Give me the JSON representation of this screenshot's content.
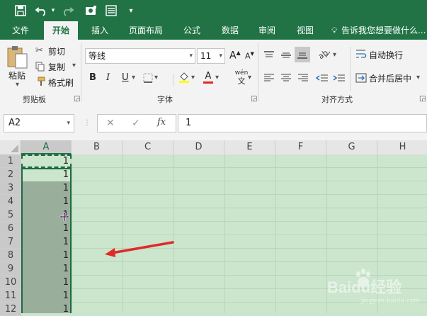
{
  "quick_access": {
    "icons": [
      "save-icon",
      "undo-icon",
      "undo-dropdown-icon",
      "redo-icon",
      "touch-mode-icon",
      "form-icon",
      "customize-icon"
    ]
  },
  "tabs": [
    "文件",
    "开始",
    "插入",
    "页面布局",
    "公式",
    "数据",
    "审阅",
    "视图"
  ],
  "tell_me": "告诉我您想要做什么...",
  "clipboard": {
    "paste": "粘贴",
    "cut": "剪切",
    "copy": "复制",
    "format_painter": "格式刷",
    "group_label": "剪贴板"
  },
  "font": {
    "name": "等线",
    "size": "11",
    "grow_glyph": "A",
    "shrink_glyph": "A",
    "bold": "B",
    "italic": "I",
    "underline": "U",
    "font_color_glyph": "A",
    "wen_top": "wén",
    "wen_bottom": "文",
    "group_label": "字体"
  },
  "alignment": {
    "wrap_text": "自动换行",
    "merge_center": "合并后居中",
    "group_label": "对齐方式"
  },
  "formula_bar": {
    "name_box": "A2",
    "cancel_glyph": "✕",
    "enter_glyph": "✓",
    "fx": "fx",
    "value": "1"
  },
  "columns": [
    "A",
    "B",
    "C",
    "D",
    "E",
    "F",
    "G",
    "H"
  ],
  "rows": [
    "1",
    "2",
    "3",
    "4",
    "5",
    "6",
    "7",
    "8",
    "9",
    "10",
    "11",
    "12"
  ],
  "column_a_values": [
    "1",
    "1",
    "1",
    "1",
    "1",
    "1",
    "1",
    "1",
    "1",
    "1",
    "1",
    "1"
  ],
  "watermark": {
    "text": "Baidu经验",
    "sub": "jingyan.baidu.com"
  },
  "colors": {
    "accent": "#217346",
    "selection": "#9aae9c",
    "marquee": "#1e6b3f",
    "arrow": "#e02a2a",
    "sheet_bg": "#cbe6cd"
  }
}
